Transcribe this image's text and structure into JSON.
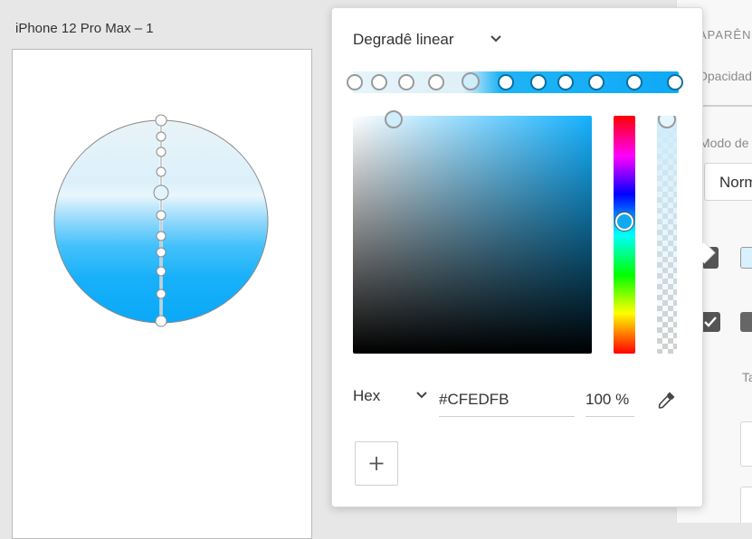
{
  "artboard": {
    "title": "iPhone 12 Pro Max – 1"
  },
  "picker": {
    "gradient_type": "Degradê linear",
    "color_mode": "Hex",
    "hex_value": "#CFEDFB",
    "opacity": "100 %",
    "add_label": "+",
    "selected_color": "#CFEDFB",
    "hue_color": "#14B1FF"
  },
  "right_panel": {
    "section_label": "APARÊN",
    "opacity_label": "Opacidade",
    "blend_label": "Modo de",
    "blend_value": "Norm",
    "size_label": "Ta"
  },
  "icons": [
    "chevron-down-icon",
    "eyedropper-icon",
    "plus-icon",
    "checkbox-checked-icon"
  ]
}
